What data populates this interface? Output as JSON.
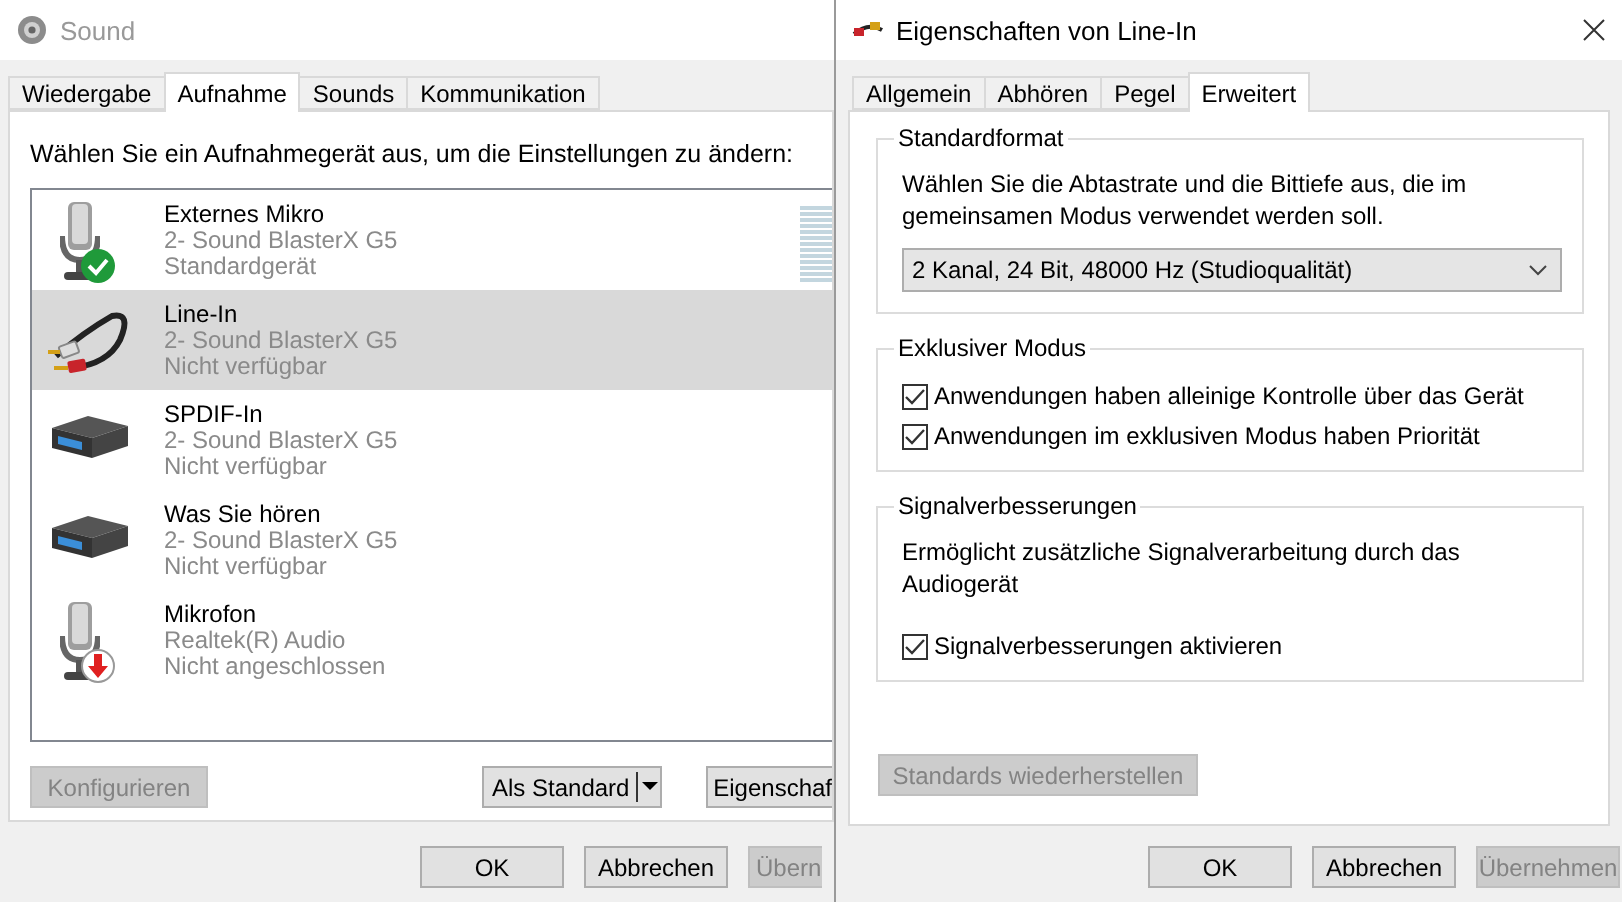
{
  "sound_window": {
    "title": "Sound",
    "tabs": [
      {
        "label": "Wiedergabe",
        "selected": false
      },
      {
        "label": "Aufnahme",
        "selected": true
      },
      {
        "label": "Sounds",
        "selected": false
      },
      {
        "label": "Kommunikation",
        "selected": false
      }
    ],
    "instruction": "Wählen Sie ein Aufnahmegerät aus, um die Einstellungen zu ändern:",
    "devices": [
      {
        "name": "Externes Mikro",
        "adapter": "2- Sound BlasterX G5",
        "status": "Standardgerät",
        "kind": "mic",
        "default_device": true,
        "unplugged": false,
        "selected": false
      },
      {
        "name": "Line-In",
        "adapter": "2- Sound BlasterX G5",
        "status": "Nicht verfügbar",
        "kind": "cable",
        "default_device": false,
        "unplugged": false,
        "selected": true
      },
      {
        "name": "SPDIF-In",
        "adapter": "2- Sound BlasterX G5",
        "status": "Nicht verfügbar",
        "kind": "card",
        "default_device": false,
        "unplugged": false,
        "selected": false
      },
      {
        "name": "Was Sie hören",
        "adapter": "2- Sound BlasterX G5",
        "status": "Nicht verfügbar",
        "kind": "card",
        "default_device": false,
        "unplugged": false,
        "selected": false
      },
      {
        "name": "Mikrofon",
        "adapter": "Realtek(R) Audio",
        "status": "Nicht angeschlossen",
        "kind": "mic",
        "default_device": false,
        "unplugged": true,
        "selected": false
      }
    ],
    "buttons": [
      {
        "label": "Konfigurieren",
        "kind": "plain",
        "disabled": true
      },
      {
        "label": "Als Standard",
        "kind": "split",
        "disabled": false
      },
      {
        "label": "Eigenschaf",
        "kind": "cut",
        "disabled": false
      }
    ],
    "footer_buttons": [
      {
        "label": "OK",
        "kind": "plain",
        "disabled": false
      },
      {
        "label": "Abbrechen",
        "kind": "plain",
        "disabled": false
      },
      {
        "label": "Übern",
        "kind": "cut",
        "disabled": true
      }
    ]
  },
  "properties_window": {
    "title": "Eigenschaften von Line-In",
    "tabs": [
      {
        "label": "Allgemein",
        "selected": false
      },
      {
        "label": "Abhören",
        "selected": false
      },
      {
        "label": "Pegel",
        "selected": false
      },
      {
        "label": "Erweitert",
        "selected": true
      }
    ],
    "groups": [
      {
        "title": "Standardformat",
        "description": "Wählen Sie die Abtastrate und die Bittiefe aus, die im gemeinsamen Modus verwendet werden soll.",
        "dropdown": {
          "value": "2 Kanal, 24 Bit, 48000 Hz (Studioqualität)"
        }
      },
      {
        "title": "Exklusiver Modus",
        "checkboxes": [
          {
            "label": "Anwendungen haben alleinige Kontrolle über das Gerät",
            "checked": true
          },
          {
            "label": "Anwendungen im exklusiven Modus haben Priorität",
            "checked": true
          }
        ]
      },
      {
        "title": "Signalverbesserungen",
        "description": "Ermöglicht zusätzliche Signalverarbeitung durch das Audiogerät",
        "checkboxes": [
          {
            "label": "Signalverbesserungen aktivieren",
            "checked": true
          }
        ]
      }
    ],
    "restore_button": {
      "label": "Standards wiederherstellen",
      "disabled": true
    },
    "footer_buttons": [
      {
        "label": "OK",
        "kind": "plain",
        "disabled": false
      },
      {
        "label": "Abbrechen",
        "kind": "plain",
        "disabled": false
      },
      {
        "label": "Übernehmen",
        "kind": "plain",
        "disabled": true
      }
    ]
  }
}
